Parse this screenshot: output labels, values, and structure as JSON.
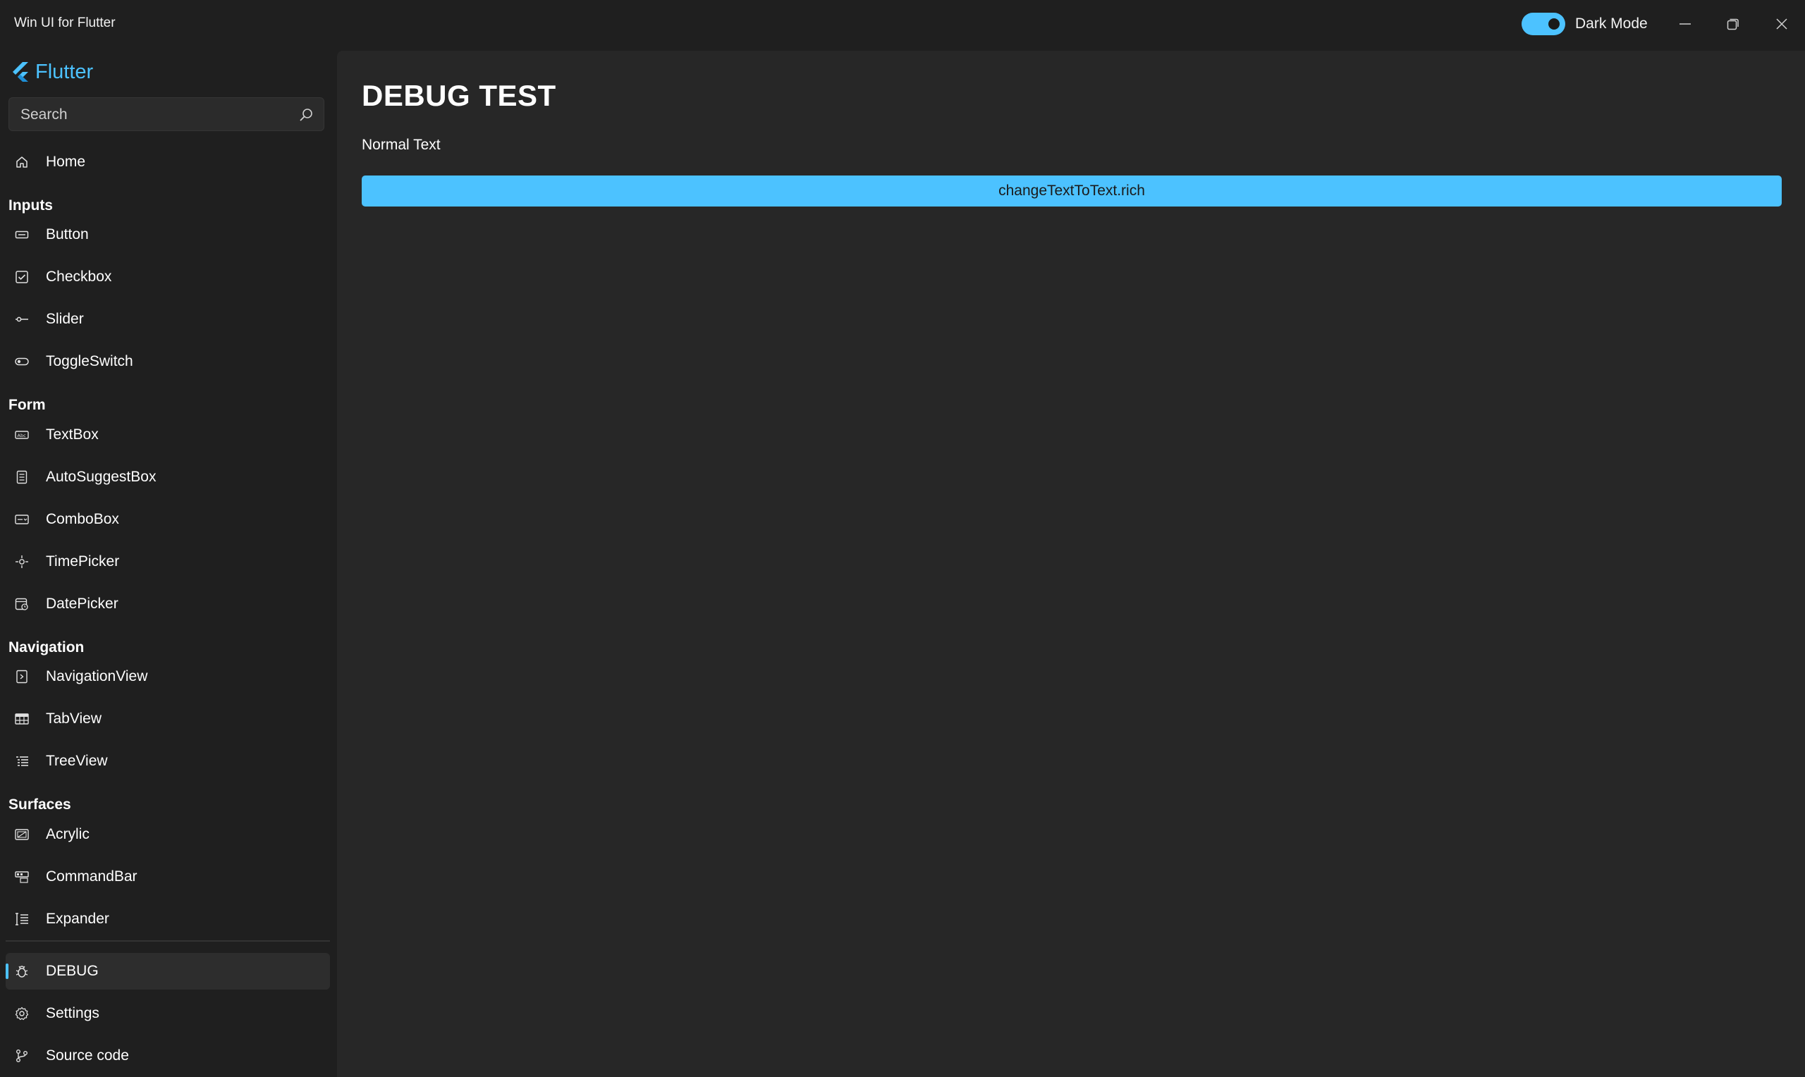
{
  "window": {
    "title": "Win UI for Flutter",
    "dark_mode_label": "Dark Mode",
    "dark_mode_on": true,
    "accent": "#4cc2ff"
  },
  "sidebar": {
    "brand": "Flutter",
    "search": {
      "placeholder": "Search",
      "value": ""
    },
    "home": {
      "label": "Home",
      "icon": "home-icon"
    },
    "groups": [
      {
        "header": "Inputs",
        "items": [
          {
            "label": "Button",
            "icon": "button-icon"
          },
          {
            "label": "Checkbox",
            "icon": "checkbox-icon"
          },
          {
            "label": "Slider",
            "icon": "slider-icon"
          },
          {
            "label": "ToggleSwitch",
            "icon": "toggle-switch-icon"
          }
        ]
      },
      {
        "header": "Form",
        "items": [
          {
            "label": "TextBox",
            "icon": "textbox-icon"
          },
          {
            "label": "AutoSuggestBox",
            "icon": "autosuggest-icon"
          },
          {
            "label": "ComboBox",
            "icon": "combobox-icon"
          },
          {
            "label": "TimePicker",
            "icon": "timepicker-icon"
          },
          {
            "label": "DatePicker",
            "icon": "datepicker-icon"
          }
        ]
      },
      {
        "header": "Navigation",
        "items": [
          {
            "label": "NavigationView",
            "icon": "navigation-view-icon"
          },
          {
            "label": "TabView",
            "icon": "tabview-icon"
          },
          {
            "label": "TreeView",
            "icon": "treeview-icon"
          }
        ]
      },
      {
        "header": "Surfaces",
        "items": [
          {
            "label": "Acrylic",
            "icon": "acrylic-icon"
          },
          {
            "label": "CommandBar",
            "icon": "commandbar-icon"
          },
          {
            "label": "Expander",
            "icon": "expander-icon"
          }
        ]
      }
    ],
    "footer": [
      {
        "label": "DEBUG",
        "icon": "bug-icon",
        "selected": true
      },
      {
        "label": "Settings",
        "icon": "gear-icon"
      },
      {
        "label": "Source code",
        "icon": "branch-icon"
      }
    ]
  },
  "main": {
    "title": "DEBUG TEST",
    "normal_text": "Normal Text",
    "button_label": "changeTextToText.rich"
  }
}
